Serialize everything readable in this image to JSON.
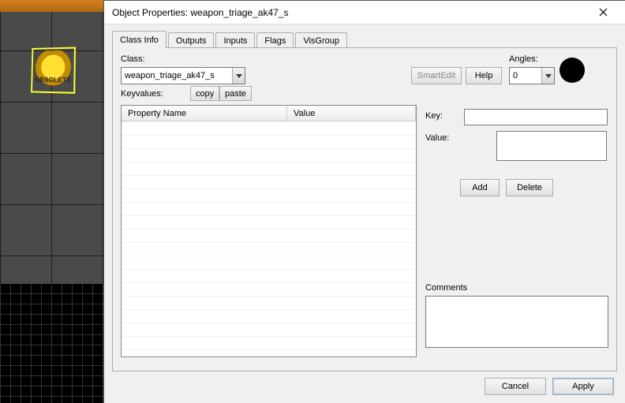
{
  "viewport": {
    "sprite_label": "OBSOLETE"
  },
  "dialog": {
    "title": "Object Properties: weapon_triage_ak47_s"
  },
  "tabs": [
    {
      "label": "Class Info",
      "active": true
    },
    {
      "label": "Outputs",
      "active": false
    },
    {
      "label": "Inputs",
      "active": false
    },
    {
      "label": "Flags",
      "active": false
    },
    {
      "label": "VisGroup",
      "active": false
    }
  ],
  "classinfo": {
    "class_label": "Class:",
    "class_value": "weapon_triage_ak47_s",
    "keyvalues_label": "Keyvalues:",
    "copy_label": "copy",
    "paste_label": "paste",
    "smartedit_label": "SmartEdit",
    "help_label": "Help",
    "angles_label": "Angles:",
    "angles_value": "0",
    "table": {
      "col_property": "Property Name",
      "col_value": "Value"
    },
    "key_label": "Key:",
    "key_value": "",
    "value_label": "Value:",
    "value_value": "",
    "add_label": "Add",
    "delete_label": "Delete",
    "comments_label": "Comments",
    "comments_value": ""
  },
  "footer": {
    "cancel_label": "Cancel",
    "apply_label": "Apply"
  }
}
